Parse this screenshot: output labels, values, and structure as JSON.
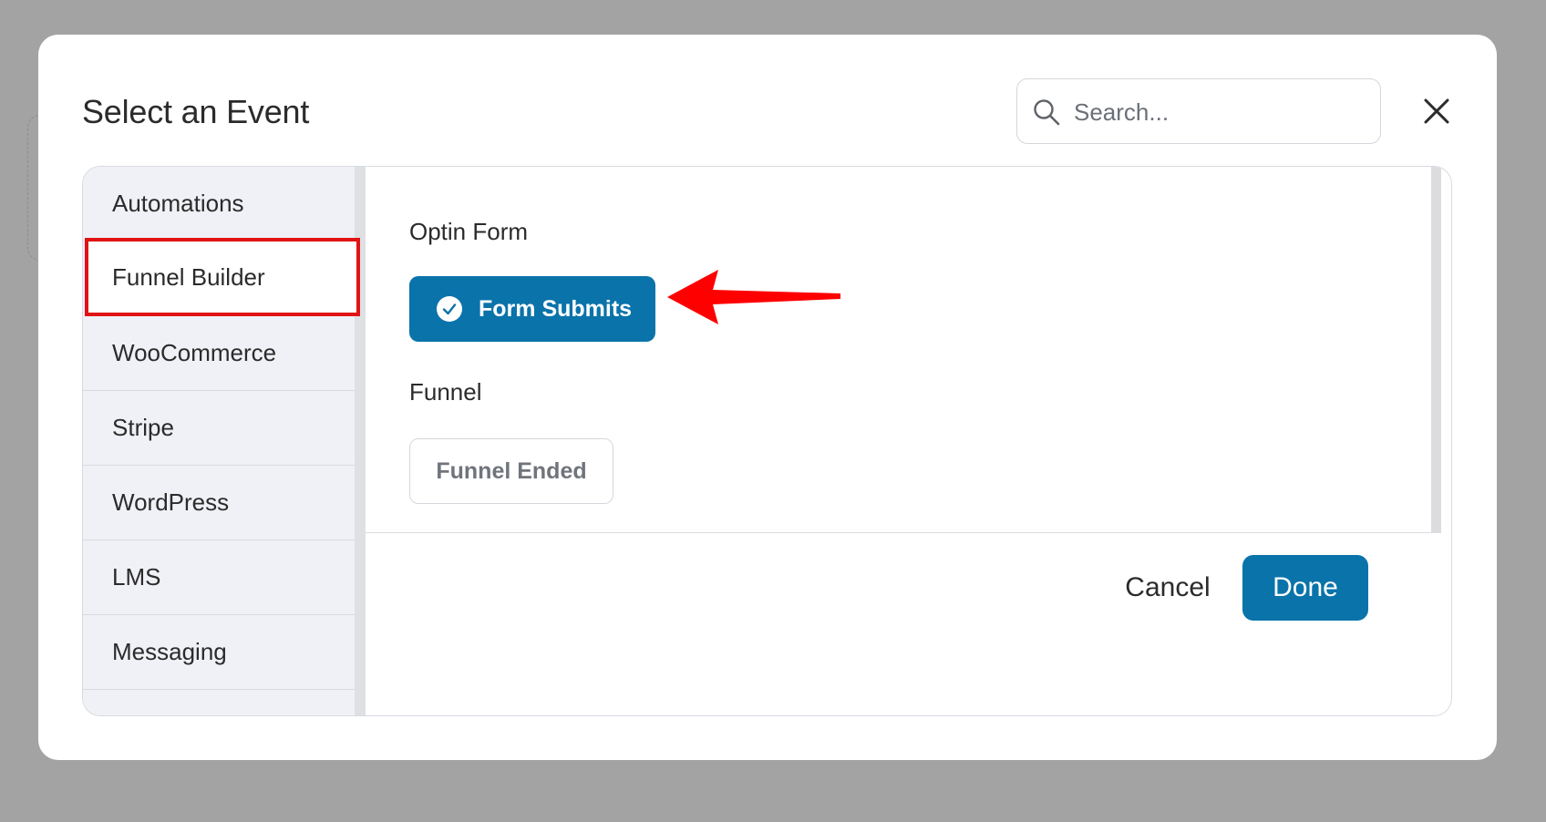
{
  "dialog": {
    "title": "Select an Event",
    "search_placeholder": "Search...",
    "close_icon": "close-icon"
  },
  "sidebar": {
    "items": [
      {
        "label": "Automations"
      },
      {
        "label": "Funnel Builder",
        "selected": true
      },
      {
        "label": "WooCommerce"
      },
      {
        "label": "Stripe"
      },
      {
        "label": "WordPress"
      },
      {
        "label": "LMS"
      },
      {
        "label": "Messaging"
      }
    ]
  },
  "groups": [
    {
      "heading": "Optin Form",
      "events": [
        {
          "label": "Form Submits",
          "selected": true
        }
      ]
    },
    {
      "heading": "Funnel",
      "events": [
        {
          "label": "Funnel Ended",
          "selected": false
        }
      ]
    }
  ],
  "footer": {
    "cancel_label": "Cancel",
    "done_label": "Done"
  },
  "colors": {
    "accent": "#0a73aa",
    "highlight_border": "#e01414",
    "annotation_arrow": "#ff0000"
  }
}
